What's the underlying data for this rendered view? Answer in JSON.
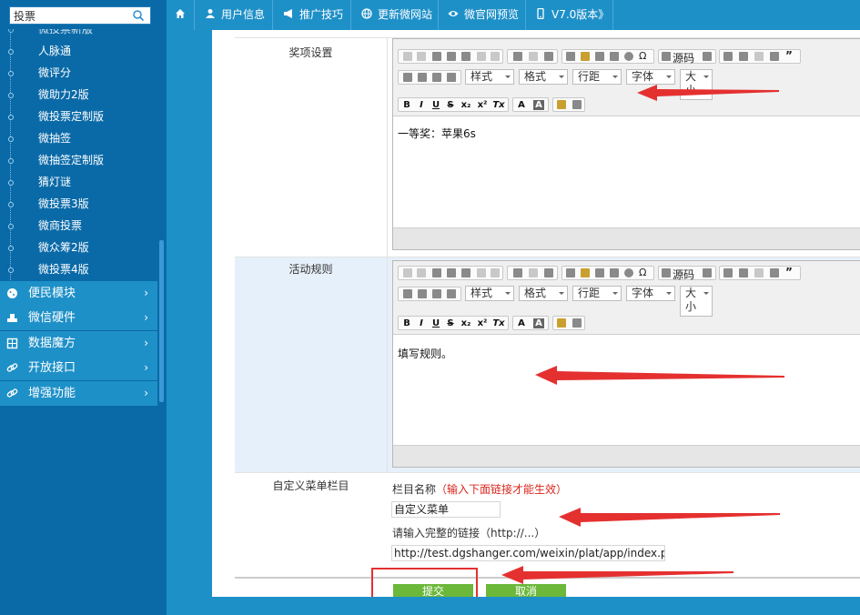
{
  "sidebar": {
    "search_value": "投票",
    "sub_items": [
      "微投票新版",
      "人脉通",
      "微评分",
      "微助力2版",
      "微投票定制版",
      "微抽签",
      "微抽签定制版",
      "猜灯谜",
      "微投票3版",
      "微商投票",
      "微众筹2版",
      "微投票4版"
    ],
    "menu": [
      {
        "label": "便民模块",
        "icon": "cookie-icon"
      },
      {
        "label": "微信硬件",
        "icon": "hardware-icon"
      },
      {
        "label": "数据魔方",
        "icon": "cube-icon"
      },
      {
        "label": "开放接口",
        "icon": "link-icon"
      },
      {
        "label": "增强功能",
        "icon": "link-icon"
      }
    ],
    "arrow_glyph": "›"
  },
  "topnav": {
    "home_icon": "home-icon",
    "items": [
      {
        "label": "用户信息",
        "icon": "user-icon"
      },
      {
        "label": "推广技巧",
        "icon": "megaphone-icon"
      },
      {
        "label": "更新微网站",
        "icon": "globe-icon"
      },
      {
        "label": "微官网预览",
        "icon": "eye-icon"
      },
      {
        "label": "V7.0版本》",
        "icon": "phone-icon"
      }
    ]
  },
  "form": {
    "prize_label": "奖项设置",
    "prize_content": "一等奖：苹果6s",
    "rules_label": "活动规则",
    "rules_content": "填写规则。",
    "menu_label": "自定义菜单栏目",
    "column_name_label": "栏目名称",
    "column_name_hint": "（输入下面链接才能生效）",
    "column_name_value": "自定义菜单",
    "link_label": "请输入完整的链接（http://...）",
    "link_value": "http://test.dgshanger.com/weixin/plat/app/index.ph"
  },
  "editor_toolbar": {
    "source_label": "源码",
    "style_label": "样式",
    "format_label": "格式",
    "lineheight_label": "行距",
    "font_label": "字体",
    "size_label_1": "大",
    "size_label_2": "小",
    "bold": "B",
    "italic": "I",
    "underline": "U",
    "strike": "S",
    "subscript": "x₂",
    "superscript": "x²",
    "removeformat": "Tx",
    "textcolor": "A",
    "bgcolor": "A"
  },
  "buttons": {
    "submit": "提交",
    "cancel": "取消"
  },
  "colors": {
    "nav_blue": "#1e90c8",
    "sidebar_blue": "#0a6aa8",
    "button_green": "#6bb83a",
    "annotation_red": "#e53030"
  }
}
